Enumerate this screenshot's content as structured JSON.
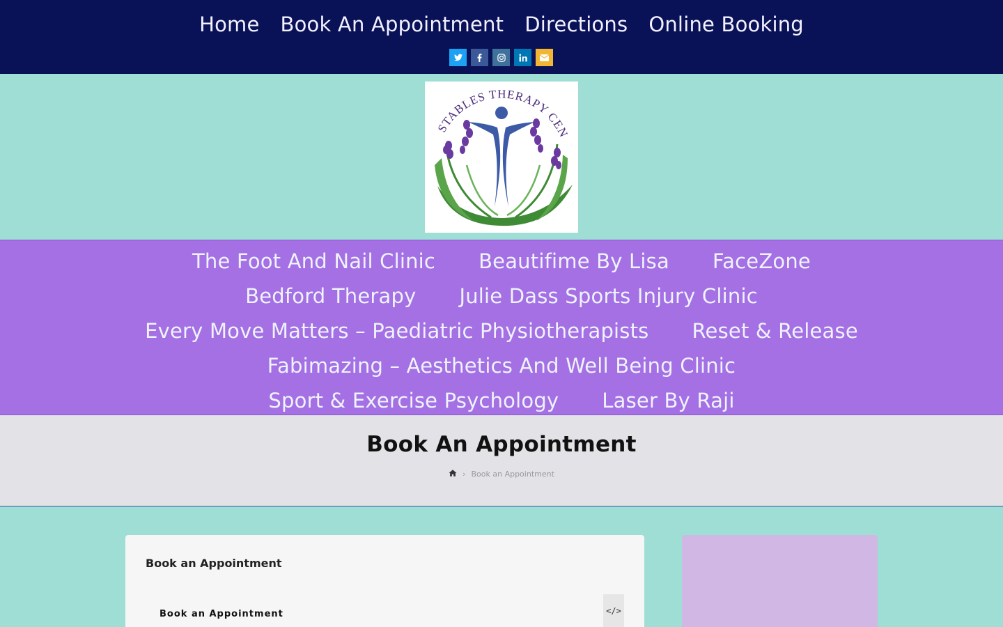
{
  "top_nav": {
    "items": [
      "Home",
      "Book An Appointment",
      "Directions",
      "Online Booking"
    ]
  },
  "social_icons": [
    "twitter-icon",
    "facebook-icon",
    "instagram-icon",
    "linkedin-icon",
    "email-icon"
  ],
  "logo": {
    "text": "STABLES THERAPY CENTRE"
  },
  "clinic_nav": {
    "row1": [
      "The Foot And Nail Clinic",
      "Beautifime By Lisa",
      "FaceZone"
    ],
    "row2": [
      "Bedford Therapy",
      "Julie Dass Sports Injury Clinic"
    ],
    "row3": [
      "Every Move Matters – Paediatric Physiotherapists",
      "Reset & Release"
    ],
    "row4": [
      "Fabimazing – Aesthetics And Well Being Clinic"
    ],
    "row5": [
      "Sport & Exercise Psychology",
      "Laser By Raji"
    ]
  },
  "page": {
    "title": "Book An Appointment",
    "breadcrumb_current": "Book an Appointment"
  },
  "content": {
    "card_title": "Book an Appointment",
    "sub_title": "Book an Appointment",
    "code_button": "</>"
  },
  "colors": {
    "top_bar": "#0a1257",
    "teal_bg": "#9fded5",
    "purple_nav": "#a470e3",
    "sidebar": "#d1b7e4"
  }
}
